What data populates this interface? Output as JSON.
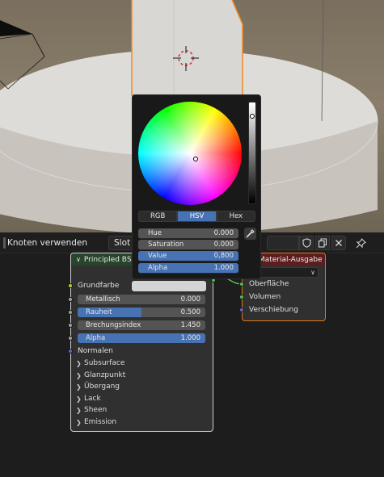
{
  "header": {
    "use_nodes_label": "Knoten verwenden",
    "slot_label": "Slot"
  },
  "bsdf_node": {
    "title": "Principled BSDF",
    "base_color_label": "Grundfarbe",
    "sliders": [
      {
        "label": "Metallisch",
        "value": "0.000",
        "fill": 0.0
      },
      {
        "label": "Rauheit",
        "value": "0.500",
        "fill": 0.5
      },
      {
        "label": "Brechungsindex",
        "value": "1.450",
        "fill": 0.0
      },
      {
        "label": "Alpha",
        "value": "1.000",
        "fill": 1.0
      }
    ],
    "normal_label": "Normalen",
    "panels": [
      "Subsurface",
      "Glanzpunkt",
      "Übergang",
      "Lack",
      "Sheen",
      "Emission"
    ]
  },
  "output_node": {
    "title": "Material-Ausgabe",
    "target": "e",
    "sockets": [
      "Oberfläche",
      "Volumen",
      "Verschiebung"
    ]
  },
  "color_picker": {
    "tabs": [
      "RGB",
      "HSV",
      "Hex"
    ],
    "active_tab": "HSV",
    "fields": [
      {
        "label": "Hue",
        "value": "0.000"
      },
      {
        "label": "Saturation",
        "value": "0.000"
      },
      {
        "label": "Value",
        "value": "0,800"
      },
      {
        "label": "Alpha",
        "value": "1.000"
      }
    ]
  },
  "icons": [
    "shield-icon",
    "copy-icon",
    "close-icon",
    "pin-icon",
    "eyedropper-icon",
    "chevron-down-icon",
    "chevron-right-icon"
  ],
  "colors": {
    "accent": "#4772b3",
    "shader_header": "#26452b",
    "output_header": "#5e1d1d",
    "selected_outline": "#e07a1a"
  }
}
